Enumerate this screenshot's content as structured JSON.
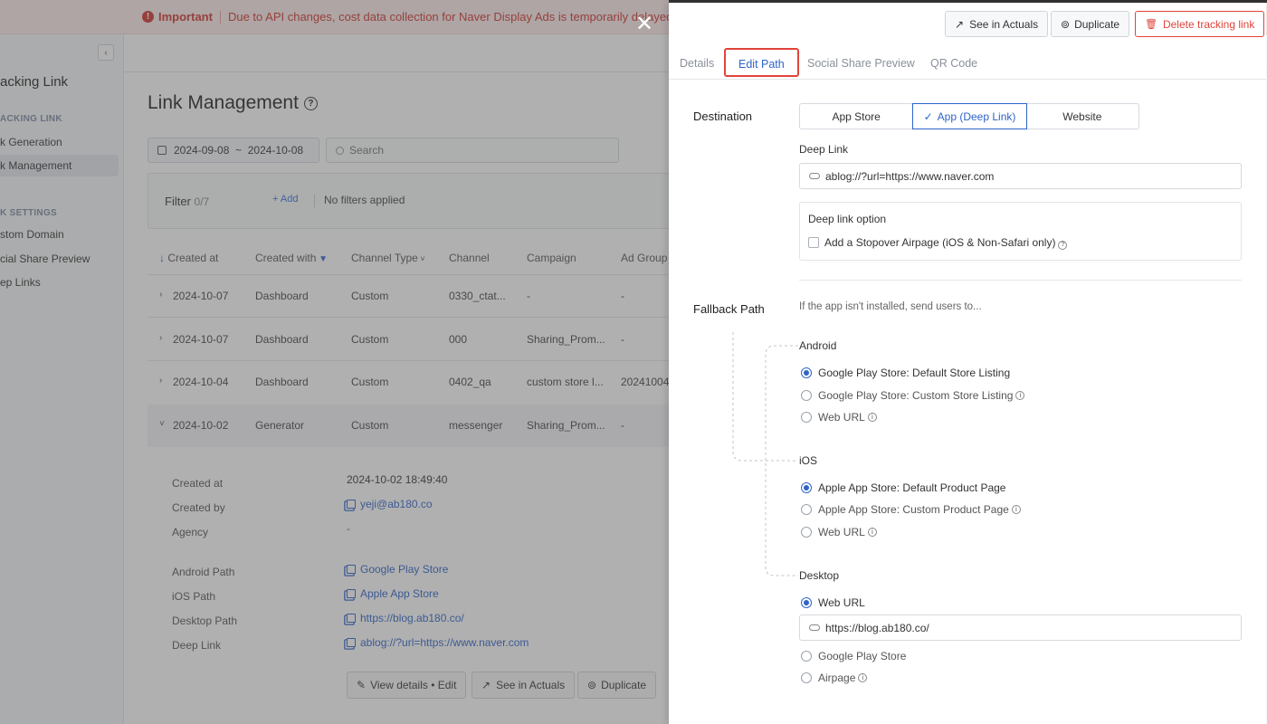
{
  "banner": {
    "important": "Important",
    "message": "Due to API changes, cost data collection for Naver Display Ads is temporarily delayed. We're wo"
  },
  "sidebar": {
    "title": "acking Link",
    "section1": "ACKING LINK",
    "items1": [
      "k Generation",
      "k Management"
    ],
    "section2": "K SETTINGS",
    "items2": [
      "stom Domain",
      "cial Share Preview",
      "ep Links"
    ]
  },
  "page": {
    "title": "Link Management",
    "date_range": "2024-09-08  ~  2024-10-08",
    "search_placeholder": "Search",
    "filter_label": "Filter",
    "filter_count": "0/7",
    "filter_add": "+ Add",
    "filter_none": "No filters applied"
  },
  "table": {
    "headers": [
      "Created at",
      "Created with",
      "Channel Type",
      "Channel",
      "Campaign",
      "Ad Group"
    ],
    "rows": [
      [
        "2024-10-07",
        "Dashboard",
        "Custom",
        "0330_ctat...",
        "-",
        "-"
      ],
      [
        "2024-10-07",
        "Dashboard",
        "Custom",
        "000",
        "Sharing_Prom...",
        "-"
      ],
      [
        "2024-10-04",
        "Dashboard",
        "Custom",
        "0402_qa",
        "custom store l...",
        "20241004"
      ],
      [
        "2024-10-02",
        "Generator",
        "Custom",
        "messenger",
        "Sharing_Prom...",
        "-"
      ]
    ]
  },
  "details": {
    "labels": [
      "Created at",
      "Created by",
      "Agency",
      "Android Path",
      "iOS Path",
      "Desktop Path",
      "Deep Link"
    ],
    "created_at": "2024-10-02 18:49:40",
    "created_by": "yeji@ab180.co",
    "agency": "-",
    "android_path": "Google Play Store",
    "ios_path": "Apple App Store",
    "desktop_path": "https://blog.ab180.co/",
    "deep_link": "ablog://?url=https://www.naver.com",
    "buttons": [
      "View details • Edit",
      "See in Actuals",
      "Duplicate"
    ]
  },
  "drawer": {
    "buttons": {
      "see_in_actuals": "See in Actuals",
      "duplicate": "Duplicate",
      "delete": "Delete tracking link"
    },
    "tabs": [
      "Details",
      "Edit Path",
      "Social Share Preview",
      "QR Code"
    ],
    "destination_label": "Destination",
    "destination_options": [
      "App Store",
      "App (Deep Link)",
      "Website"
    ],
    "deep_link_label": "Deep Link",
    "deep_link_value": "ablog://?url=https://www.naver.com",
    "deep_link_option_title": "Deep link option",
    "deep_link_option_checkbox": "Add a Stopover Airpage (iOS & Non-Safari only)",
    "fallback_label": "Fallback Path",
    "fallback_hint": "If the app isn't installed, send users to...",
    "android": {
      "label": "Android",
      "options": [
        "Google Play Store: Default Store Listing",
        "Google Play Store: Custom Store Listing",
        "Web URL"
      ]
    },
    "ios": {
      "label": "iOS",
      "options": [
        "Apple App Store: Default Product Page",
        "Apple App Store: Custom Product Page",
        "Web URL"
      ]
    },
    "desktop": {
      "label": "Desktop",
      "options": [
        "Web URL",
        "Google Play Store",
        "Airpage"
      ],
      "web_url_value": "https://blog.ab180.co/"
    }
  },
  "colors": {
    "accent": "#2e63c9",
    "danger": "#e0443b"
  }
}
